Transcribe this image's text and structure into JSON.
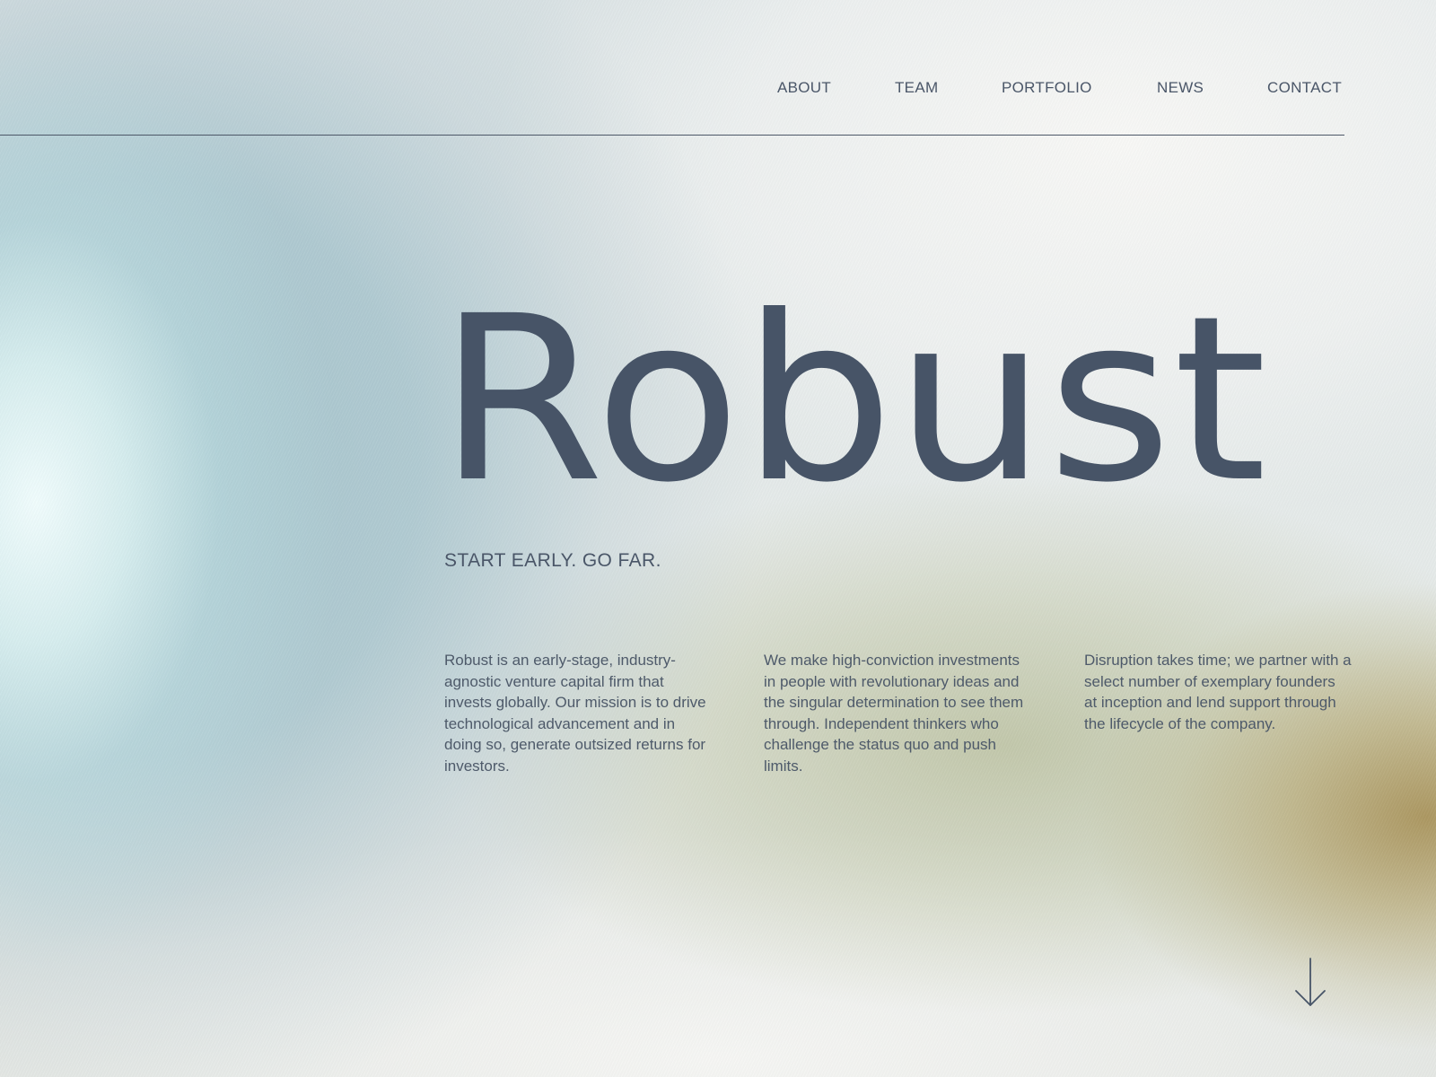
{
  "nav": {
    "items": [
      {
        "label": "ABOUT"
      },
      {
        "label": "TEAM"
      },
      {
        "label": "PORTFOLIO"
      },
      {
        "label": "NEWS"
      },
      {
        "label": "CONTACT"
      }
    ]
  },
  "hero": {
    "wordmark": "Robust",
    "tagline": "START EARLY. GO FAR."
  },
  "columns": [
    {
      "text": "Robust is an early-stage, industry-agnostic venture capital firm that invests globally. Our mission is to drive technological advancement and in doing so, generate outsized returns for investors."
    },
    {
      "text": "We make high-conviction investments in people with revolutionary ideas and the singular determination to see them through. Independent thinkers who challenge the status quo and push limits."
    },
    {
      "text": "Disruption takes time; we partner with a select number of exemplary founders at inception and lend support through the lifecycle of the company."
    }
  ],
  "scroll": {
    "icon": "arrow-down-icon"
  },
  "colors": {
    "text": "#475467",
    "rule": "#4d5868",
    "blue_glow": "#a3c3cc",
    "olive_glow": "#aa945c"
  }
}
